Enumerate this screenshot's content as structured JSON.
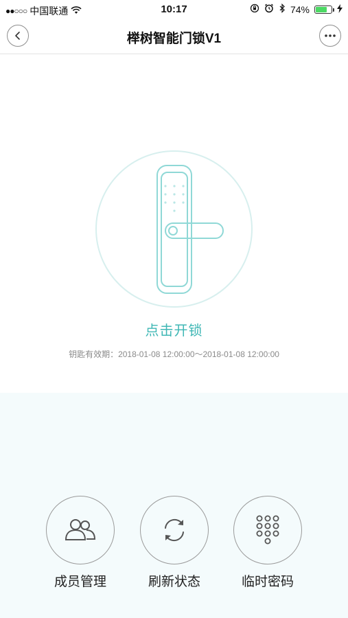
{
  "status_bar": {
    "signal": "●●○○○",
    "carrier": "中国联通",
    "time": "10:17",
    "battery_percent": "74%",
    "battery_level": 0.74
  },
  "nav": {
    "title": "榉树智能门锁V1"
  },
  "lock": {
    "unlock_label": "点击开锁",
    "validity": "钥匙有效期：2018-01-08 12:00:00～2018-01-08 12:00:00",
    "accent_color": "#3fb7b5"
  },
  "actions": [
    {
      "label": "成员管理",
      "icon": "members-icon"
    },
    {
      "label": "刷新状态",
      "icon": "refresh-icon"
    },
    {
      "label": "临时密码",
      "icon": "keypad-icon"
    }
  ]
}
